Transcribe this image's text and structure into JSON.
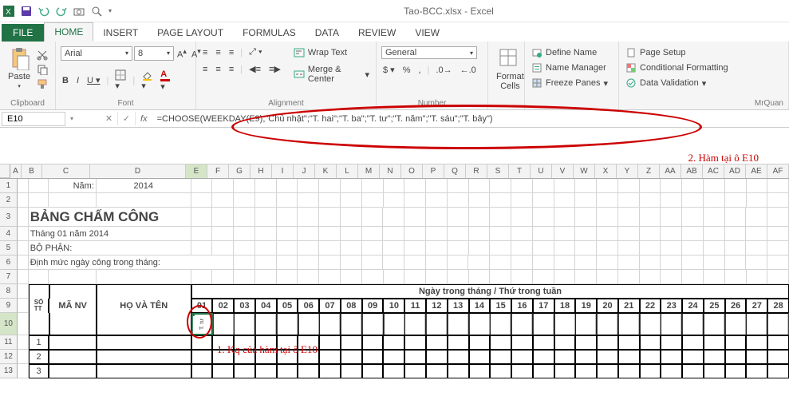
{
  "app": {
    "title": "Tao-BCC.xlsx - Excel"
  },
  "tabs": {
    "file": "FILE",
    "home": "HOME",
    "insert": "INSERT",
    "page_layout": "PAGE LAYOUT",
    "formulas": "FORMULAS",
    "data": "DATA",
    "review": "REVIEW",
    "view": "VIEW"
  },
  "ribbon": {
    "clipboard": {
      "label": "Clipboard",
      "paste": "Paste"
    },
    "font": {
      "label": "Font",
      "name": "Arial",
      "size": "8",
      "bold": "B",
      "italic": "I",
      "underline": "U"
    },
    "alignment": {
      "label": "Alignment",
      "wrap": "Wrap Text",
      "merge": "Merge & Center"
    },
    "number": {
      "label": "Number",
      "format": "General"
    },
    "cells": {
      "format": "Format\nCells"
    },
    "names": {
      "define": "Define Name",
      "manager": "Name Manager",
      "freeze": "Freeze Panes"
    },
    "right": {
      "page_setup": "Page Setup",
      "cond_fmt": "Conditional Formatting",
      "data_val": "Data Validation"
    },
    "user": "MrQuan"
  },
  "formula": {
    "cell_ref": "E10",
    "value": "=CHOOSE(WEEKDAY(E9);\"Chủ nhật\";\"T. hai\";\"T. ba\";\"T. tư\";\"T. năm\";\"T. sáu\";\"T. bảy\")"
  },
  "annotations": {
    "a1": "1. Kq của hàm tại ô E10",
    "a2": "2. Hàm tại ô E10"
  },
  "sheet": {
    "year_label": "Năm:",
    "year_value": "2014",
    "title": "BẢNG CHẤM CÔNG",
    "month": "Tháng 01 năm 2014",
    "dept": "BỘ PHẬN:",
    "norm": "Định mức ngày công trong tháng:",
    "header_days": "Ngày trong tháng / Thứ trong tuần",
    "col_stt": "SỐ\nTT",
    "col_manv": "MÃ NV",
    "col_hoten": "HỌ VÀ TÊN",
    "days": [
      "01",
      "02",
      "03",
      "04",
      "05",
      "06",
      "07",
      "08",
      "09",
      "10",
      "11",
      "12",
      "13",
      "14",
      "15",
      "16",
      "17",
      "18",
      "19",
      "20",
      "21",
      "22",
      "23",
      "24",
      "25",
      "26",
      "27",
      "28"
    ],
    "e10_value": "T. tư",
    "stt": [
      "1",
      "2",
      "3"
    ]
  },
  "cols": {
    "letters": [
      "A",
      "B",
      "C",
      "D",
      "E",
      "F",
      "G",
      "H",
      "I",
      "J",
      "K",
      "L",
      "M",
      "N",
      "O",
      "P",
      "Q",
      "R",
      "S",
      "T",
      "U",
      "V",
      "W",
      "X",
      "Y",
      "Z",
      "AA",
      "AB",
      "AC",
      "AD",
      "AE",
      "AF"
    ]
  }
}
